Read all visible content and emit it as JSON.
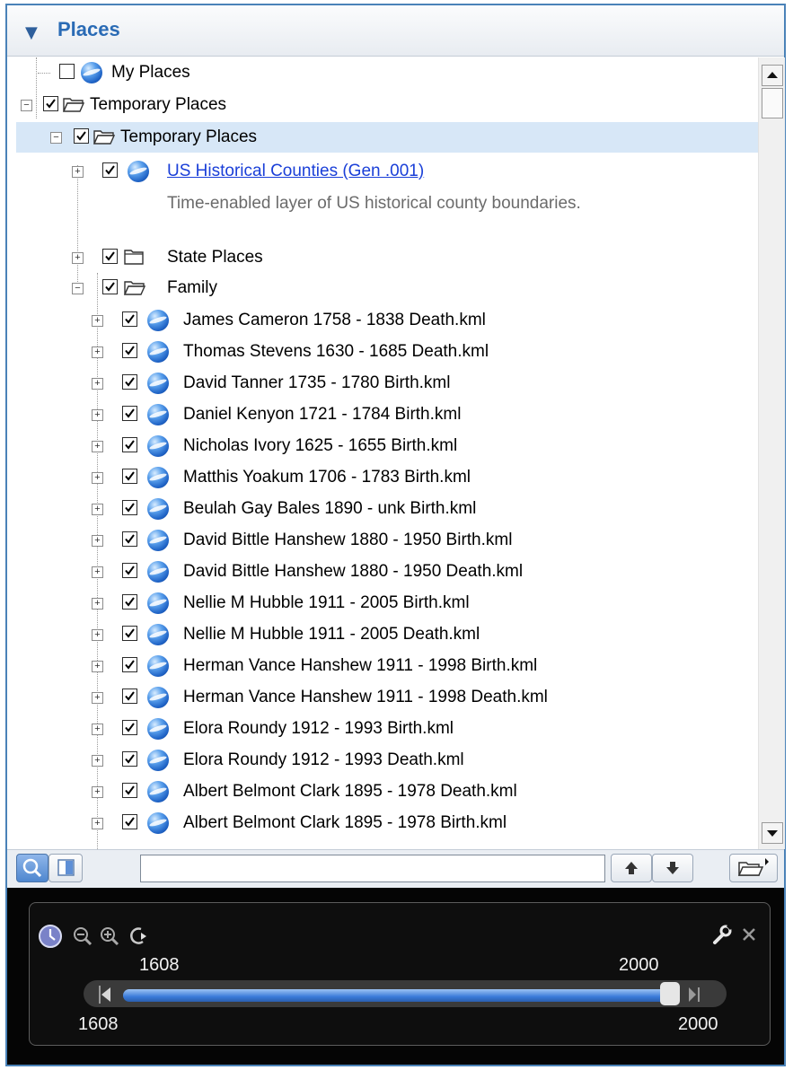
{
  "panel": {
    "title": "Places"
  },
  "tree": {
    "my_places": "My Places",
    "temporary_places": "Temporary Places",
    "temporary_places_child": "Temporary Places",
    "us_counties": {
      "label": "US Historical Counties (Gen .001)",
      "description": "Time-enabled layer of US historical county boundaries."
    },
    "state_places": "State Places",
    "family": "Family",
    "family_items": [
      "James Cameron 1758 - 1838 Death.kml",
      "Thomas Stevens 1630 - 1685 Death.kml",
      "David Tanner 1735 - 1780 Birth.kml",
      "Daniel Kenyon 1721 - 1784 Birth.kml",
      "Nicholas Ivory 1625 - 1655 Birth.kml",
      "Matthis Yoakum 1706 - 1783 Birth.kml",
      "Beulah Gay Bales 1890 - unk Birth.kml",
      "David Bittle Hanshew 1880 - 1950 Birth.kml",
      "David Bittle Hanshew 1880 - 1950 Death.kml",
      "Nellie M Hubble 1911 - 2005 Birth.kml",
      "Nellie M Hubble 1911 - 2005 Death.kml",
      "Herman Vance Hanshew 1911 - 1998 Birth.kml",
      "Herman Vance Hanshew 1911 - 1998 Death.kml",
      "Elora Roundy 1912 - 1993 Birth.kml",
      "Elora Roundy 1912 - 1993 Death.kml",
      "Albert Belmont Clark 1895 - 1978 Death.kml",
      "Albert Belmont Clark 1895 - 1978 Birth.kml"
    ]
  },
  "search": {
    "value": ""
  },
  "time_slider": {
    "range_start_top": "1608",
    "range_end_top": "2000",
    "axis_start": "1608",
    "axis_end": "2000"
  }
}
